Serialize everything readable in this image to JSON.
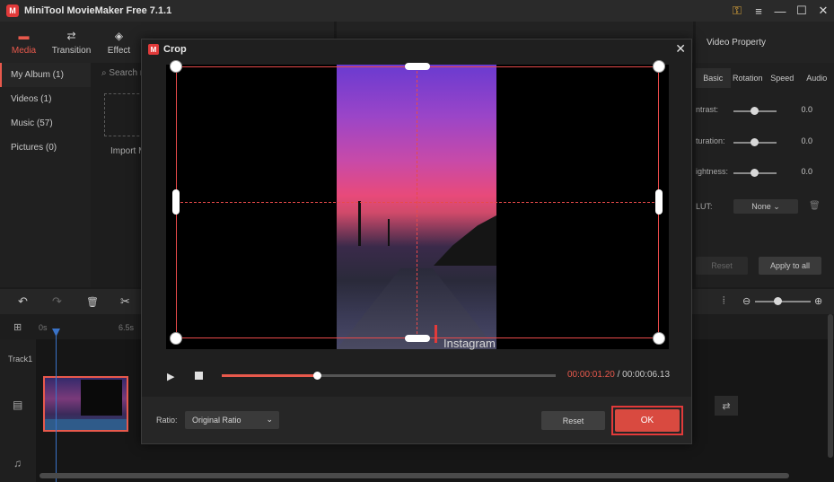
{
  "app": {
    "title": "MiniTool MovieMaker Free 7.1.1",
    "logo_text": "M"
  },
  "window_controls": {
    "key": "⚿",
    "menu": "≡",
    "minimize": "—",
    "maximize": "☐",
    "close": "✕"
  },
  "toolbar": {
    "items": [
      {
        "label": "Media",
        "icon": "▬"
      },
      {
        "label": "Transition",
        "icon": "⇄"
      },
      {
        "label": "Effect",
        "icon": "◈"
      }
    ]
  },
  "properties": {
    "title": "Video Property",
    "tabs": [
      "Basic",
      "Rotation",
      "Speed",
      "Audio"
    ],
    "rows": [
      {
        "label": "ntrast:",
        "value": "0.0"
      },
      {
        "label": "turation:",
        "value": "0.0"
      },
      {
        "label": "ightness:",
        "value": "0.0"
      }
    ],
    "lut_label": "LUT:",
    "lut_value": "None ⌄",
    "trash_icon": "🗑",
    "reset_label": "Reset",
    "apply_all_label": "Apply to all"
  },
  "sidebar": {
    "items": [
      {
        "label": "My Album  (1)"
      },
      {
        "label": "Videos  (1)"
      },
      {
        "label": "Music  (57)"
      },
      {
        "label": "Pictures  (0)"
      }
    ]
  },
  "media": {
    "search_placeholder": "⌕  Search n",
    "import_label": "Import M"
  },
  "timeline": {
    "undo": "↶",
    "redo": "↷",
    "delete": "🗑",
    "split": "✂",
    "zoom_split": "⦙",
    "zoom_minus": "⊖",
    "zoom_plus": "⊕",
    "zoom_level": 0.4,
    "ruler_start": "0s",
    "ruler_mid": "6.5s",
    "add_track": "⊞",
    "track1": "Track1",
    "film": "▤",
    "music": "♫",
    "swap": "⇄"
  },
  "crop_dialog": {
    "title": "Crop",
    "logo_text": "M",
    "close": "✕",
    "watermark": "Instagram",
    "play": "▶",
    "progress": 0.2857,
    "current_time": "00:00:01.20",
    "separator": " / ",
    "total_time": "00:00:06.13",
    "ratio_label": "Ratio:",
    "ratio_value": "Original Ratio",
    "ratio_chevron": "⌄",
    "reset_label": "Reset",
    "ok_label": "OK"
  },
  "colors": {
    "accent": "#e8594c",
    "highlight": "#e23a3a",
    "background": "#1b1b1b"
  }
}
